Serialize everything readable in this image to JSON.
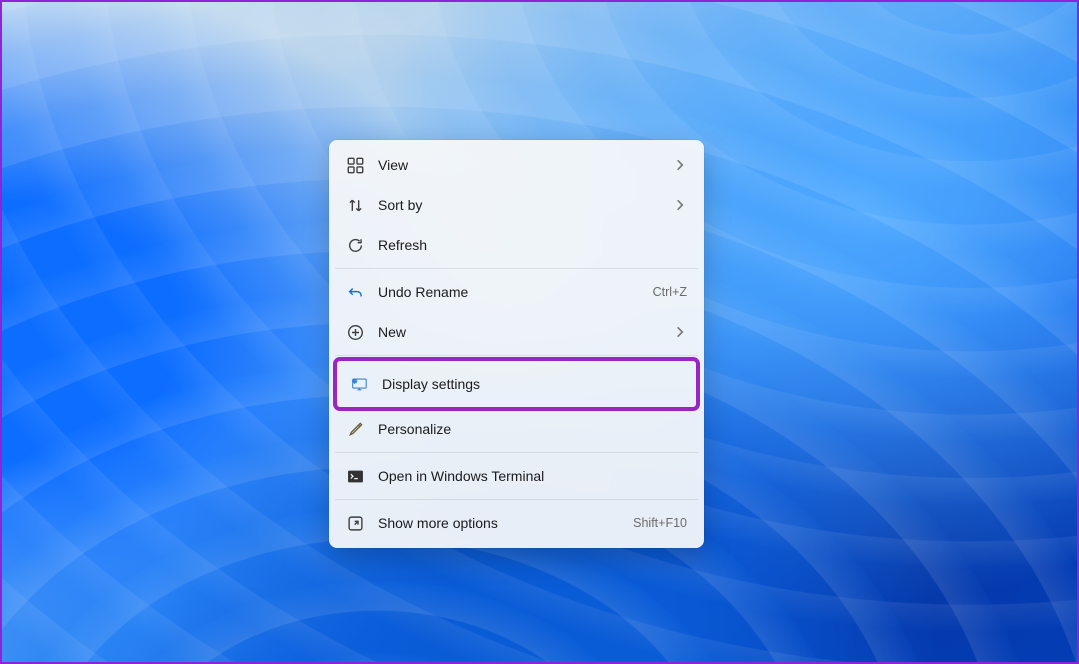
{
  "context_menu": {
    "items": {
      "view": {
        "label": "View",
        "has_submenu": true
      },
      "sort": {
        "label": "Sort by",
        "has_submenu": true
      },
      "refresh": {
        "label": "Refresh"
      },
      "undo": {
        "label": "Undo Rename",
        "shortcut": "Ctrl+Z"
      },
      "new": {
        "label": "New",
        "has_submenu": true
      },
      "display": {
        "label": "Display settings"
      },
      "personalize": {
        "label": "Personalize"
      },
      "terminal": {
        "label": "Open in Windows Terminal"
      },
      "more": {
        "label": "Show more options",
        "shortcut": "Shift+F10"
      }
    }
  },
  "colors": {
    "highlight": "#9b25c2"
  }
}
